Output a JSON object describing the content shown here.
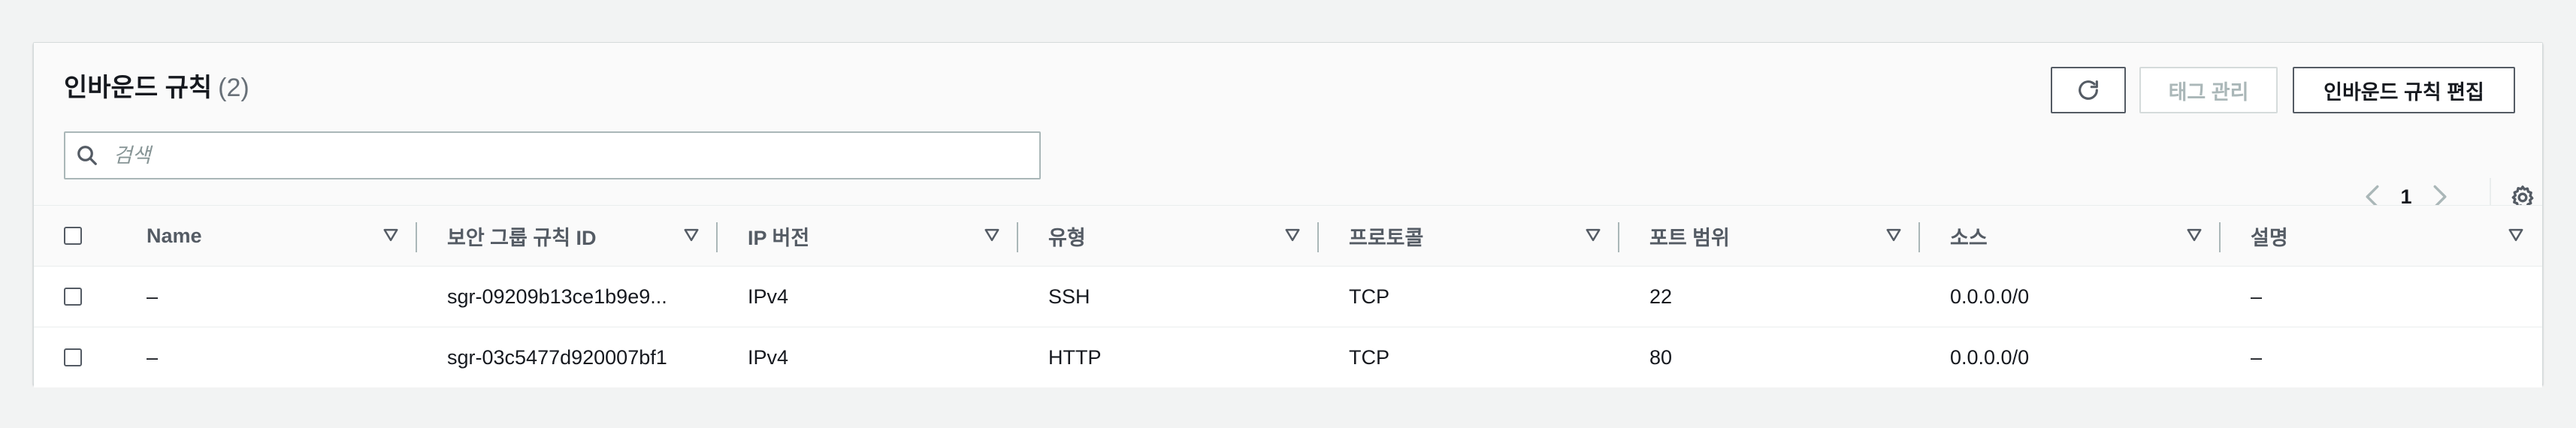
{
  "header": {
    "title": "인바운드 규칙",
    "count": "(2)"
  },
  "actions": {
    "refresh_icon": "refresh-icon",
    "manage_tags_label": "태그 관리",
    "edit_rules_label": "인바운드 규칙 편집"
  },
  "search": {
    "placeholder": "검색",
    "value": ""
  },
  "pagination": {
    "current_page": "1"
  },
  "table": {
    "columns": [
      "Name",
      "보안 그룹 규칙 ID",
      "IP 버전",
      "유형",
      "프로토콜",
      "포트 범위",
      "소스",
      "설명"
    ],
    "rows": [
      [
        "–",
        "sgr-09209b13ce1b9e9...",
        "IPv4",
        "SSH",
        "TCP",
        "22",
        "0.0.0.0/0",
        "–"
      ],
      [
        "–",
        "sgr-03c5477d920007bf1",
        "IPv4",
        "HTTP",
        "TCP",
        "80",
        "0.0.0.0/0",
        "–"
      ]
    ]
  },
  "colors": {
    "accent": "#545b64",
    "text": "#16191f",
    "muted": "#687078",
    "background": "#f2f3f3"
  }
}
